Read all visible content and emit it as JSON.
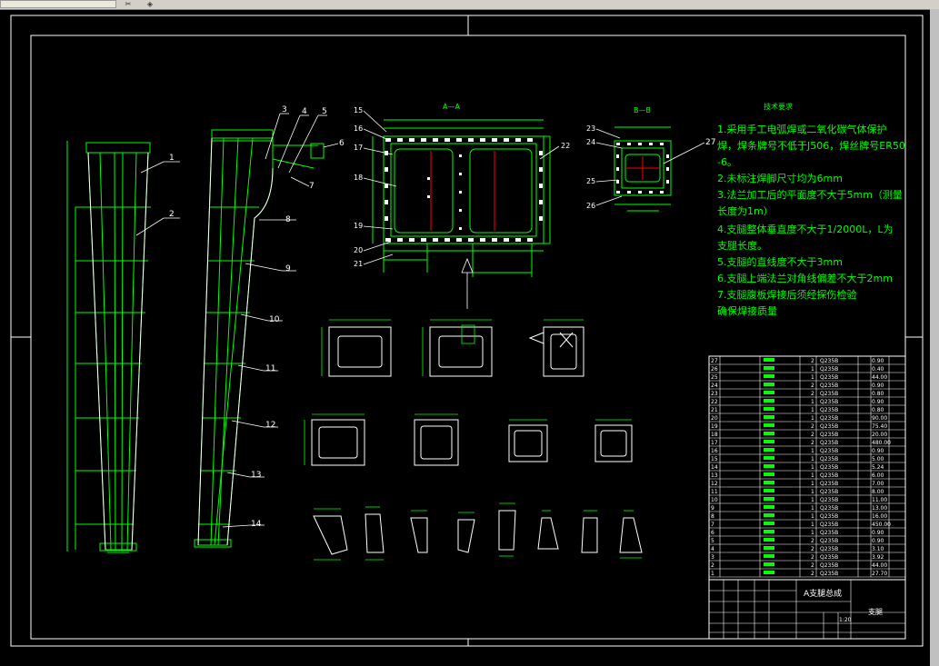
{
  "toolbar": {
    "icons": [
      "cut-icon",
      "properties-icon"
    ]
  },
  "drawing": {
    "section_a_title": "A—A",
    "section_b_title": "B—B",
    "notes_title": "技术要求",
    "notes": [
      "1.采用手工电弧焊或二氧化碳气体保护",
      "焊，焊条牌号不低于J506，焊丝牌号ER50",
      "-6。",
      "2.未标注焊脚尺寸均为6mm",
      "3.法兰加工后的平面度不大于5mm（测量",
      "长度为1m）",
      "4.支腿整体垂直度不大于1/2000L，L为",
      "支腿长度。",
      "5.支腿的直线度不大于3mm",
      "6.支腿上端法兰对角线偏差不大于2mm",
      "7.支腿腹板焊接后须经探伤检验",
      "确保焊接质量"
    ],
    "side_leader_labels": [
      "1",
      "2",
      "3",
      "4",
      "5",
      "6",
      "7",
      "8",
      "9",
      "10",
      "11",
      "12",
      "13",
      "14"
    ],
    "section_a_labels": [
      "15",
      "16",
      "17",
      "18",
      "19",
      "20",
      "21",
      "22"
    ],
    "section_b_labels": [
      "23",
      "24",
      "25",
      "26",
      "27"
    ],
    "title_block_name": "A支腿总成",
    "title_block_scale": "1:20",
    "title_block_sheet": "支腿",
    "bom_rows": [
      {
        "no": "27",
        "qty": "2",
        "mat": "Q235B",
        "w": "0.90"
      },
      {
        "no": "26",
        "qty": "1",
        "mat": "Q235B",
        "w": "0.40"
      },
      {
        "no": "25",
        "qty": "1",
        "mat": "Q235B",
        "w": "44.00"
      },
      {
        "no": "24",
        "qty": "2",
        "mat": "Q235B",
        "w": "0.90"
      },
      {
        "no": "23",
        "qty": "2",
        "mat": "Q235B",
        "w": "0.80"
      },
      {
        "no": "22",
        "qty": "1",
        "mat": "Q235B",
        "w": "0.90"
      },
      {
        "no": "21",
        "qty": "1",
        "mat": "Q235B",
        "w": "0.80"
      },
      {
        "no": "20",
        "qty": "1",
        "mat": "Q235B",
        "w": "90.00"
      },
      {
        "no": "19",
        "qty": "2",
        "mat": "Q235B",
        "w": "75.40"
      },
      {
        "no": "18",
        "qty": "2",
        "mat": "Q235B",
        "w": "20.00"
      },
      {
        "no": "17",
        "qty": "2",
        "mat": "Q235B",
        "w": "480.00"
      },
      {
        "no": "16",
        "qty": "1",
        "mat": "Q235B",
        "w": "0.90"
      },
      {
        "no": "15",
        "qty": "1",
        "mat": "Q235B",
        "w": "5.00"
      },
      {
        "no": "14",
        "qty": "1",
        "mat": "Q235B",
        "w": "5.24"
      },
      {
        "no": "13",
        "qty": "1",
        "mat": "Q235B",
        "w": "6.00"
      },
      {
        "no": "12",
        "qty": "1",
        "mat": "Q235B",
        "w": "7.00"
      },
      {
        "no": "11",
        "qty": "1",
        "mat": "Q235B",
        "w": "8.00"
      },
      {
        "no": "10",
        "qty": "1",
        "mat": "Q235B",
        "w": "11.00"
      },
      {
        "no": "9",
        "qty": "1",
        "mat": "Q235B",
        "w": "13.00"
      },
      {
        "no": "8",
        "qty": "1",
        "mat": "Q235B",
        "w": "16.00"
      },
      {
        "no": "7",
        "qty": "1",
        "mat": "Q235B",
        "w": "450.00"
      },
      {
        "no": "6",
        "qty": "1",
        "mat": "Q235B",
        "w": "0.90"
      },
      {
        "no": "5",
        "qty": "2",
        "mat": "Q235B",
        "w": "0.90"
      },
      {
        "no": "4",
        "qty": "2",
        "mat": "Q235B",
        "w": "3.10"
      },
      {
        "no": "3",
        "qty": "2",
        "mat": "Q235B",
        "w": "3.92"
      },
      {
        "no": "2",
        "qty": "2",
        "mat": "Q235B",
        "w": "44.00"
      },
      {
        "no": "1",
        "qty": "2",
        "mat": "Q235B",
        "w": "27.70"
      }
    ]
  }
}
